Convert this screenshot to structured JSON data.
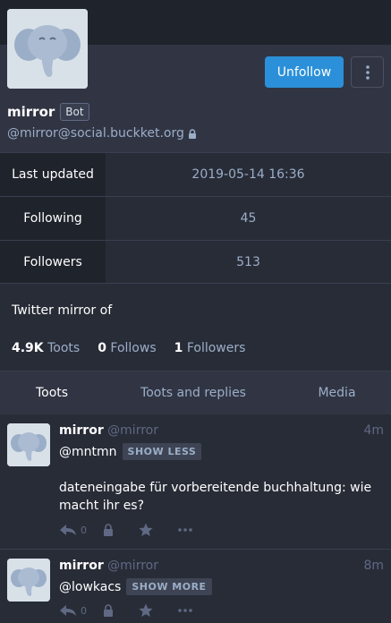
{
  "profile": {
    "display_name": "mirror",
    "bot_badge": "Bot",
    "acct": "@mirror@social.buckket.org",
    "unfollow_label": "Unfollow",
    "bio": "Twitter mirror of"
  },
  "fields": [
    {
      "name": "Last updated",
      "value": "2019-05-14 16:36"
    },
    {
      "name": "Following",
      "value": "45"
    },
    {
      "name": "Followers",
      "value": "513"
    }
  ],
  "counts": {
    "toots_num": "4.9K",
    "toots_label": "Toots",
    "follows_num": "0",
    "follows_label": "Follows",
    "followers_num": "1",
    "followers_label": "Followers"
  },
  "tabs": [
    "Toots",
    "Toots and replies",
    "Media"
  ],
  "statuses": [
    {
      "name": "mirror",
      "handle": "@mirror",
      "time": "4m",
      "mention": "@mntmn",
      "toggle": "SHOW LESS",
      "body": "dateneingabe für vorbereitende buchhaltung: wie macht ihr es?",
      "replies": "0"
    },
    {
      "name": "mirror",
      "handle": "@mirror",
      "time": "8m",
      "mention": "@lowkacs",
      "toggle": "SHOW MORE",
      "replies": "0"
    }
  ],
  "colors": {
    "accent": "#2b90d9",
    "bg": "#282c37",
    "muted": "#9baec8"
  },
  "icons": [
    "elephant-avatar",
    "more-icon",
    "lock-icon",
    "reply-icon",
    "boost-lock-icon",
    "star-icon",
    "ellipsis-icon"
  ]
}
